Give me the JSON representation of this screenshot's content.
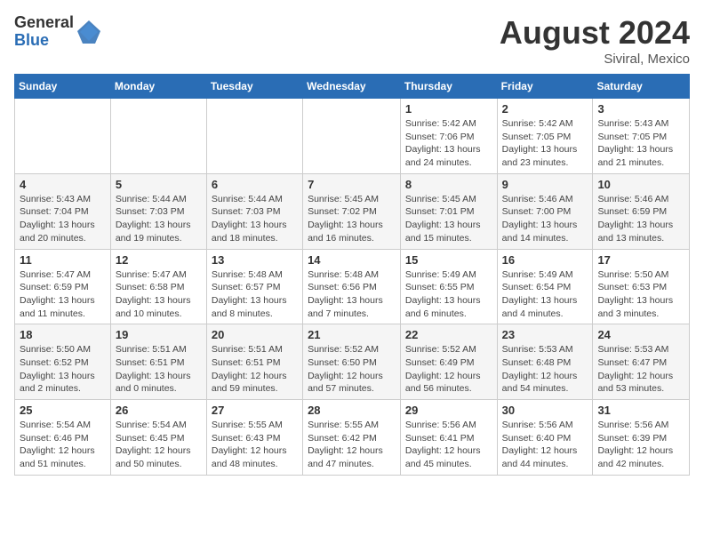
{
  "logo": {
    "general": "General",
    "blue": "Blue"
  },
  "title": {
    "month_year": "August 2024",
    "location": "Siviral, Mexico"
  },
  "days_of_week": [
    "Sunday",
    "Monday",
    "Tuesday",
    "Wednesday",
    "Thursday",
    "Friday",
    "Saturday"
  ],
  "weeks": [
    [
      {
        "day": "",
        "info": ""
      },
      {
        "day": "",
        "info": ""
      },
      {
        "day": "",
        "info": ""
      },
      {
        "day": "",
        "info": ""
      },
      {
        "day": "1",
        "info": "Sunrise: 5:42 AM\nSunset: 7:06 PM\nDaylight: 13 hours\nand 24 minutes."
      },
      {
        "day": "2",
        "info": "Sunrise: 5:42 AM\nSunset: 7:05 PM\nDaylight: 13 hours\nand 23 minutes."
      },
      {
        "day": "3",
        "info": "Sunrise: 5:43 AM\nSunset: 7:05 PM\nDaylight: 13 hours\nand 21 minutes."
      }
    ],
    [
      {
        "day": "4",
        "info": "Sunrise: 5:43 AM\nSunset: 7:04 PM\nDaylight: 13 hours\nand 20 minutes."
      },
      {
        "day": "5",
        "info": "Sunrise: 5:44 AM\nSunset: 7:03 PM\nDaylight: 13 hours\nand 19 minutes."
      },
      {
        "day": "6",
        "info": "Sunrise: 5:44 AM\nSunset: 7:03 PM\nDaylight: 13 hours\nand 18 minutes."
      },
      {
        "day": "7",
        "info": "Sunrise: 5:45 AM\nSunset: 7:02 PM\nDaylight: 13 hours\nand 16 minutes."
      },
      {
        "day": "8",
        "info": "Sunrise: 5:45 AM\nSunset: 7:01 PM\nDaylight: 13 hours\nand 15 minutes."
      },
      {
        "day": "9",
        "info": "Sunrise: 5:46 AM\nSunset: 7:00 PM\nDaylight: 13 hours\nand 14 minutes."
      },
      {
        "day": "10",
        "info": "Sunrise: 5:46 AM\nSunset: 6:59 PM\nDaylight: 13 hours\nand 13 minutes."
      }
    ],
    [
      {
        "day": "11",
        "info": "Sunrise: 5:47 AM\nSunset: 6:59 PM\nDaylight: 13 hours\nand 11 minutes."
      },
      {
        "day": "12",
        "info": "Sunrise: 5:47 AM\nSunset: 6:58 PM\nDaylight: 13 hours\nand 10 minutes."
      },
      {
        "day": "13",
        "info": "Sunrise: 5:48 AM\nSunset: 6:57 PM\nDaylight: 13 hours\nand 8 minutes."
      },
      {
        "day": "14",
        "info": "Sunrise: 5:48 AM\nSunset: 6:56 PM\nDaylight: 13 hours\nand 7 minutes."
      },
      {
        "day": "15",
        "info": "Sunrise: 5:49 AM\nSunset: 6:55 PM\nDaylight: 13 hours\nand 6 minutes."
      },
      {
        "day": "16",
        "info": "Sunrise: 5:49 AM\nSunset: 6:54 PM\nDaylight: 13 hours\nand 4 minutes."
      },
      {
        "day": "17",
        "info": "Sunrise: 5:50 AM\nSunset: 6:53 PM\nDaylight: 13 hours\nand 3 minutes."
      }
    ],
    [
      {
        "day": "18",
        "info": "Sunrise: 5:50 AM\nSunset: 6:52 PM\nDaylight: 13 hours\nand 2 minutes."
      },
      {
        "day": "19",
        "info": "Sunrise: 5:51 AM\nSunset: 6:51 PM\nDaylight: 13 hours\nand 0 minutes."
      },
      {
        "day": "20",
        "info": "Sunrise: 5:51 AM\nSunset: 6:51 PM\nDaylight: 12 hours\nand 59 minutes."
      },
      {
        "day": "21",
        "info": "Sunrise: 5:52 AM\nSunset: 6:50 PM\nDaylight: 12 hours\nand 57 minutes."
      },
      {
        "day": "22",
        "info": "Sunrise: 5:52 AM\nSunset: 6:49 PM\nDaylight: 12 hours\nand 56 minutes."
      },
      {
        "day": "23",
        "info": "Sunrise: 5:53 AM\nSunset: 6:48 PM\nDaylight: 12 hours\nand 54 minutes."
      },
      {
        "day": "24",
        "info": "Sunrise: 5:53 AM\nSunset: 6:47 PM\nDaylight: 12 hours\nand 53 minutes."
      }
    ],
    [
      {
        "day": "25",
        "info": "Sunrise: 5:54 AM\nSunset: 6:46 PM\nDaylight: 12 hours\nand 51 minutes."
      },
      {
        "day": "26",
        "info": "Sunrise: 5:54 AM\nSunset: 6:45 PM\nDaylight: 12 hours\nand 50 minutes."
      },
      {
        "day": "27",
        "info": "Sunrise: 5:55 AM\nSunset: 6:43 PM\nDaylight: 12 hours\nand 48 minutes."
      },
      {
        "day": "28",
        "info": "Sunrise: 5:55 AM\nSunset: 6:42 PM\nDaylight: 12 hours\nand 47 minutes."
      },
      {
        "day": "29",
        "info": "Sunrise: 5:56 AM\nSunset: 6:41 PM\nDaylight: 12 hours\nand 45 minutes."
      },
      {
        "day": "30",
        "info": "Sunrise: 5:56 AM\nSunset: 6:40 PM\nDaylight: 12 hours\nand 44 minutes."
      },
      {
        "day": "31",
        "info": "Sunrise: 5:56 AM\nSunset: 6:39 PM\nDaylight: 12 hours\nand 42 minutes."
      }
    ]
  ]
}
